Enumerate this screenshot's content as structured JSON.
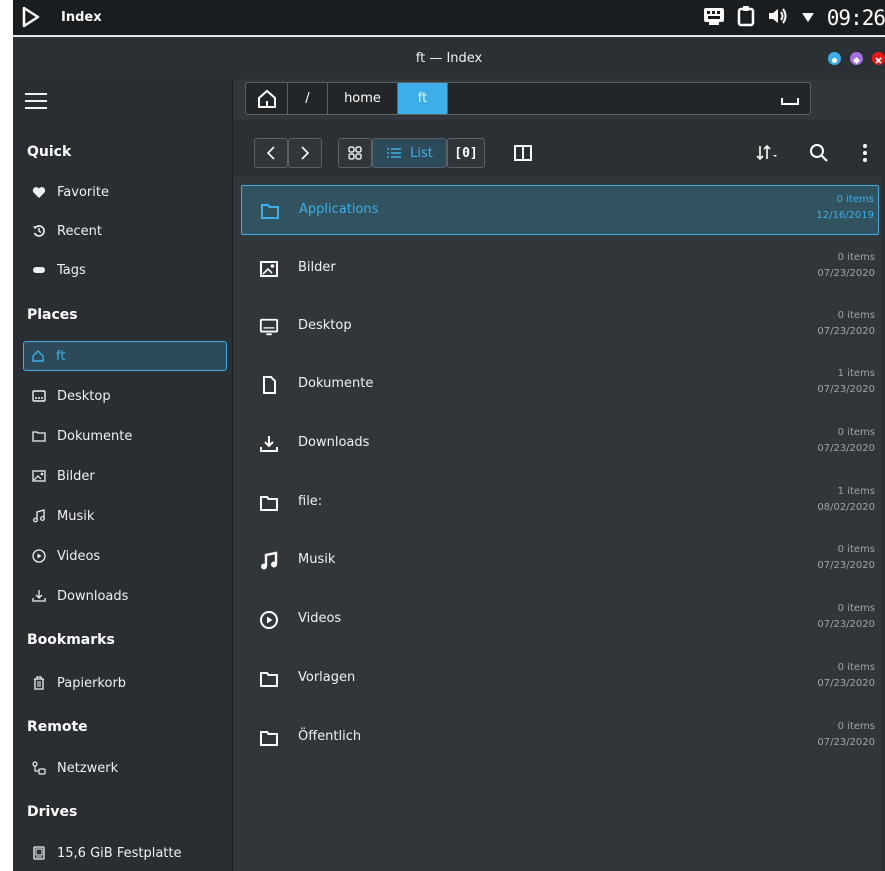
{
  "panel": {
    "app_name": "Index",
    "clock": "09:26"
  },
  "window": {
    "title": "ft — Index"
  },
  "breadcrumb": {
    "items": [
      "/",
      "home",
      "ft"
    ]
  },
  "toolbar": {
    "list_label": "List",
    "bracket_label": "[0]"
  },
  "sidebar": {
    "quick_title": "Quick",
    "quick": [
      "Favorite",
      "Recent",
      "Tags"
    ],
    "places_title": "Places",
    "places": [
      "ft",
      "Desktop",
      "Dokumente",
      "Bilder",
      "Musik",
      "Videos",
      "Downloads"
    ],
    "bookmarks_title": "Bookmarks",
    "bookmarks": [
      "Papierkorb"
    ],
    "remote_title": "Remote",
    "remote": [
      "Netzwerk"
    ],
    "drives_title": "Drives",
    "drives": [
      "15,6 GiB Festplatte"
    ]
  },
  "files": [
    {
      "name": "Applications",
      "count": "0 items",
      "date": "12/16/2019",
      "icon": "folder-icon"
    },
    {
      "name": "Bilder",
      "count": "0 items",
      "date": "07/23/2020",
      "icon": "image-icon"
    },
    {
      "name": "Desktop",
      "count": "0 items",
      "date": "07/23/2020",
      "icon": "monitor-icon"
    },
    {
      "name": "Dokumente",
      "count": "1 items",
      "date": "07/23/2020",
      "icon": "document-icon"
    },
    {
      "name": "Downloads",
      "count": "0 items",
      "date": "07/23/2020",
      "icon": "download-icon"
    },
    {
      "name": "file:",
      "count": "1 items",
      "date": "08/02/2020",
      "icon": "folder-icon"
    },
    {
      "name": "Musik",
      "count": "0 items",
      "date": "07/23/2020",
      "icon": "music-icon"
    },
    {
      "name": "Videos",
      "count": "0 items",
      "date": "07/23/2020",
      "icon": "play-icon"
    },
    {
      "name": "Vorlagen",
      "count": "0 items",
      "date": "07/23/2020",
      "icon": "folder-icon"
    },
    {
      "name": "Öffentlich",
      "count": "0 items",
      "date": "07/23/2020",
      "icon": "folder-icon"
    }
  ],
  "colors": {
    "accent": "#3daee9",
    "background": "#31363b",
    "sidebar": "#2a2e32"
  }
}
